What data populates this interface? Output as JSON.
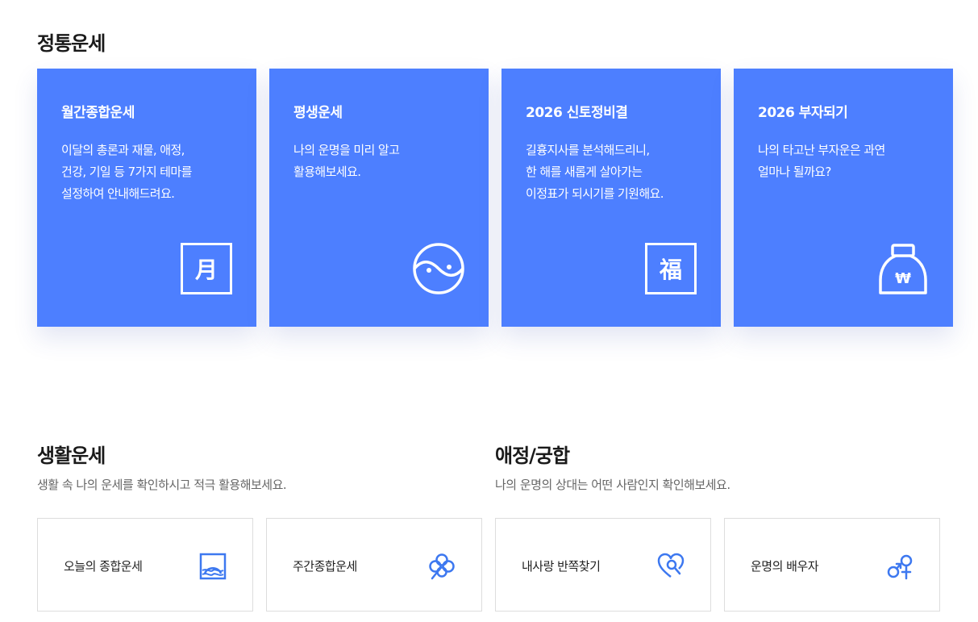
{
  "traditional": {
    "title": "정통운세",
    "cards": [
      {
        "title": "월간종합운세",
        "desc": [
          "이달의 총론과 재물, 애정,",
          "건강, 기일 등 7가지 테마를",
          "설정하여 안내해드려요."
        ],
        "icon": "moon-character-icon",
        "icon_char": "月"
      },
      {
        "title": "평생운세",
        "desc": [
          "나의 운명을 미리 알고",
          "활용해보세요."
        ],
        "icon": "yin-yang-icon"
      },
      {
        "title": "2026 신토정비결",
        "desc": [
          "길흉지사를 분석해드리니,",
          "한 해를 새롭게 살아가는",
          "이정표가 되시기를 기원해요."
        ],
        "icon": "fortune-character-icon",
        "icon_char": "福"
      },
      {
        "title": "2026 부자되기",
        "desc": [
          "나의 타고난 부자운은 과연",
          "얼마나 될까요?"
        ],
        "icon": "money-bag-icon",
        "icon_char": "₩"
      }
    ]
  },
  "life": {
    "title": "생활운세",
    "subtitle": "생활 속 나의 운세를 확인하시고 적극 활용해보세요.",
    "tiles": [
      {
        "label": "오늘의 종합운세",
        "icon": "sunrise-window-icon"
      },
      {
        "label": "주간종합운세",
        "icon": "clover-icon"
      }
    ]
  },
  "love": {
    "title": "애정/궁합",
    "subtitle": "나의 운명의 상대는 어떤 사람인지 확인해보세요.",
    "tiles": [
      {
        "label": "내사랑 반쪽찾기",
        "icon": "heart-search-icon"
      },
      {
        "label": "운명의 배우자",
        "icon": "gender-symbols-icon"
      }
    ]
  },
  "colors": {
    "card_bg": "#4d7fff",
    "icon_blue": "#3d78f0",
    "tile_border": "#dddddd"
  }
}
